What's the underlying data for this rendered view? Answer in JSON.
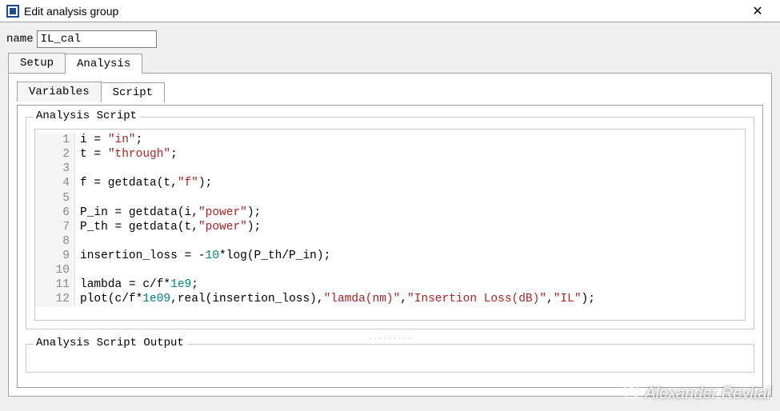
{
  "window": {
    "title": "Edit analysis group"
  },
  "form": {
    "name_label": "name",
    "name_value": "IL_cal"
  },
  "tabs_outer": {
    "items": [
      {
        "label": "Setup",
        "active": false
      },
      {
        "label": "Analysis",
        "active": true
      }
    ]
  },
  "tabs_inner": {
    "items": [
      {
        "label": "Variables",
        "active": false
      },
      {
        "label": "Script",
        "active": true
      }
    ]
  },
  "script_panel": {
    "legend": "Analysis Script",
    "lines": [
      {
        "n": 1,
        "tokens": [
          {
            "t": "i = ",
            "c": "op"
          },
          {
            "t": "\"in\"",
            "c": "str"
          },
          {
            "t": ";",
            "c": "op"
          }
        ]
      },
      {
        "n": 2,
        "tokens": [
          {
            "t": "t = ",
            "c": "op"
          },
          {
            "t": "\"through\"",
            "c": "str"
          },
          {
            "t": ";",
            "c": "op"
          }
        ]
      },
      {
        "n": 3,
        "tokens": []
      },
      {
        "n": 4,
        "tokens": [
          {
            "t": "f = getdata(t,",
            "c": "op"
          },
          {
            "t": "\"f\"",
            "c": "str"
          },
          {
            "t": ");",
            "c": "op"
          }
        ]
      },
      {
        "n": 5,
        "tokens": []
      },
      {
        "n": 6,
        "tokens": [
          {
            "t": "P_in = getdata(i,",
            "c": "op"
          },
          {
            "t": "\"power\"",
            "c": "str"
          },
          {
            "t": ");",
            "c": "op"
          }
        ]
      },
      {
        "n": 7,
        "tokens": [
          {
            "t": "P_th = getdata(t,",
            "c": "op"
          },
          {
            "t": "\"power\"",
            "c": "str"
          },
          {
            "t": ");",
            "c": "op"
          }
        ]
      },
      {
        "n": 8,
        "tokens": []
      },
      {
        "n": 9,
        "tokens": [
          {
            "t": "insertion_loss = -",
            "c": "op"
          },
          {
            "t": "10",
            "c": "num"
          },
          {
            "t": "*log(P_th/P_in);",
            "c": "op"
          }
        ]
      },
      {
        "n": 10,
        "tokens": []
      },
      {
        "n": 11,
        "tokens": [
          {
            "t": "lambda = c/f*",
            "c": "op"
          },
          {
            "t": "1e9",
            "c": "num"
          },
          {
            "t": ";",
            "c": "op"
          }
        ]
      },
      {
        "n": 12,
        "tokens": [
          {
            "t": "plot(c/f*",
            "c": "op"
          },
          {
            "t": "1e09",
            "c": "num"
          },
          {
            "t": ",real(insertion_loss),",
            "c": "op"
          },
          {
            "t": "\"lamda(nm)\"",
            "c": "str"
          },
          {
            "t": ",",
            "c": "op"
          },
          {
            "t": "\"Insertion Loss(dB)\"",
            "c": "str"
          },
          {
            "t": ",",
            "c": "op"
          },
          {
            "t": "\"IL\"",
            "c": "str"
          },
          {
            "t": ");",
            "c": "op"
          }
        ]
      }
    ]
  },
  "output_panel": {
    "legend": "Analysis Script Output"
  },
  "watermark": {
    "text": "Alexander Revital"
  }
}
